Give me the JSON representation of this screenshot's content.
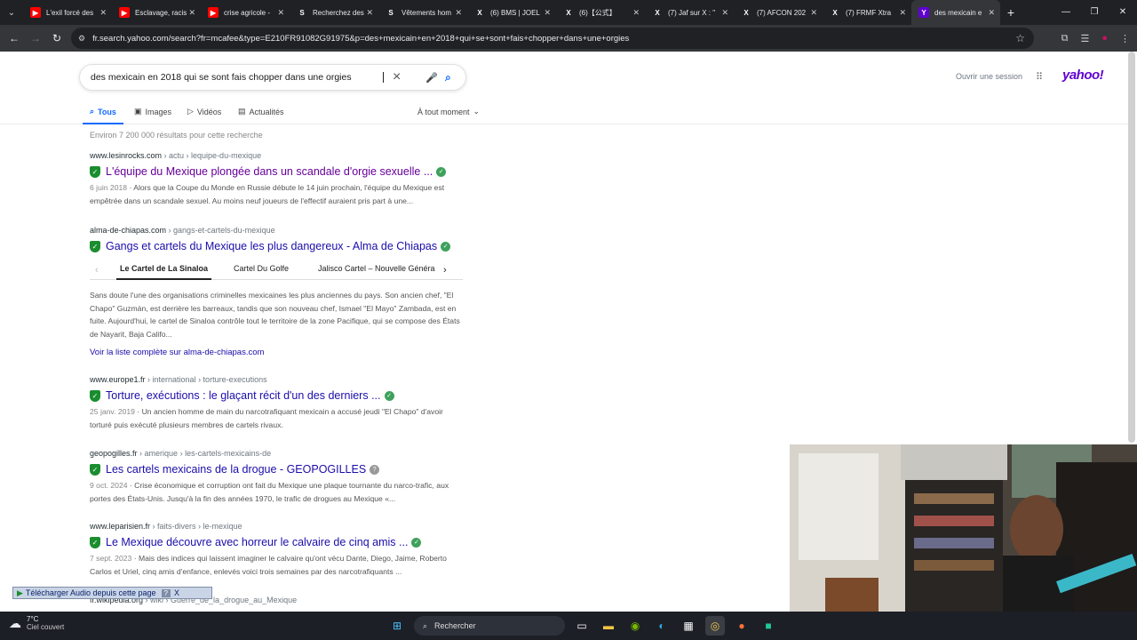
{
  "browser": {
    "tabs": [
      {
        "title": "L'exil forcé des",
        "icon": "youtube-icon",
        "color": "#ff0000",
        "glyph": "▶"
      },
      {
        "title": "Esclavage, racis",
        "icon": "youtube-icon",
        "color": "#ff0000",
        "glyph": "▶"
      },
      {
        "title": "crise agricole - ",
        "icon": "youtube-icon",
        "color": "#ff0000",
        "glyph": "▶"
      },
      {
        "title": "Recherchez des",
        "icon": "s-icon",
        "color": "#202124",
        "glyph": "S"
      },
      {
        "title": "Vêtements hom",
        "icon": "s-icon",
        "color": "#202124",
        "glyph": "S"
      },
      {
        "title": "(6) BMS | JOEL",
        "icon": "x-icon",
        "color": "#202124",
        "glyph": "X"
      },
      {
        "title": "(6)【公式】",
        "icon": "x-icon",
        "color": "#202124",
        "glyph": "X"
      },
      {
        "title": "(7) Jaf sur X : \"",
        "icon": "x-icon",
        "color": "#202124",
        "glyph": "X"
      },
      {
        "title": "(7) AFCON 202",
        "icon": "x-icon",
        "color": "#202124",
        "glyph": "X"
      },
      {
        "title": "(7) FRMF Xtra",
        "icon": "x-icon",
        "color": "#202124",
        "glyph": "X"
      },
      {
        "title": "des mexicain e",
        "icon": "yahoo-icon",
        "color": "#5f01d1",
        "glyph": "Y"
      }
    ],
    "url": "fr.search.yahoo.com/search?fr=mcafee&type=E210FR91082G91975&p=des+mexicain+en+2018+qui+se+sont+fais+chopper+dans+une+orgies"
  },
  "search": {
    "query": "des mexicain en 2018 qui se sont fais chopper dans une orgies",
    "signin": "Ouvrir une session",
    "logo": "yahoo!",
    "tabs": {
      "all": "Tous",
      "images": "Images",
      "videos": "Vidéos",
      "news": "Actualités",
      "time": "À tout moment"
    },
    "count": "Environ 7 200 000 résultats pour cette recherche"
  },
  "results": [
    {
      "domain": "www.lesinrocks.com",
      "path": " › actu › lequipe-du-mexique",
      "title": "L'équipe du Mexique plongée dans un scandale d'orgie sexuelle ...",
      "snippet_date": "6 juin 2018",
      "snippet": " · Alors que la Coupe du Monde en Russie débute le 14 juin prochain, l'équipe du Mexique est empêtrée dans un scandale sexuel. Au moins neuf joueurs de l'effectif auraient pris part à une..."
    },
    {
      "domain": "alma-de-chiapas.com",
      "path": " › gangs-et-cartels-du-mexique",
      "title": "Gangs et cartels du Mexique les plus dangereux - Alma de Chiapas",
      "carousel": [
        "Le Cartel de La Sinaloa",
        "Cartel Du Golfe",
        "Jalisco Cartel – Nouvelle Généra"
      ],
      "snippet": "Sans doute l'une des organisations criminelles mexicaines les plus anciennes du pays. Son ancien chef, \"El Chapo\" Guzmán, est derrière les barreaux, tandis que son nouveau chef, Ismael \"El Mayo\" Zambada, est en fuite. Aujourd'hui, le cartel de Sinaloa contrôle tout le territoire de la zone Pacifique, qui se compose des États de Nayarit, Baja Califo...",
      "more": "Voir la liste complète sur alma-de-chiapas.com"
    },
    {
      "domain": "www.europe1.fr",
      "path": " › international › torture-executions",
      "title": "Torture, exécutions : le glaçant récit d'un des derniers ...",
      "snippet_date": "25 janv. 2019",
      "snippet": " · Un ancien homme de main du narcotrafiquant mexicain a accusé jeudi \"El Chapo\" d'avoir torturé puis exécuté plusieurs membres de cartels rivaux."
    },
    {
      "domain": "geopogilles.fr",
      "path": " › amerique › les-cartels-mexicains-de",
      "title": "Les cartels mexicains de la drogue - GEOPOGILLES",
      "snippet_date": "9 oct. 2024",
      "snippet": " · Crise économique et corruption ont fait du Mexique une plaque tournante du narco-trafic, aux portes des États-Unis. Jusqu'à la fin des années 1970, le trafic de drogues au Mexique «..."
    },
    {
      "domain": "www.leparisien.fr",
      "path": " › faits-divers › le-mexique",
      "title": "Le Mexique découvre avec horreur le calvaire de cinq amis ...",
      "snippet_date": "7 sept. 2023",
      "snippet": " · Mais des indices qui laissent imaginer le calvaire qu'ont vécu Dante, Diego, Jaime, Roberto Carlos et Uriel, cinq amis d'enfance, enlevés voici trois semaines par des narcotrafiquants ..."
    },
    {
      "domain": "fr.wikipedia.org",
      "path": " › wiki › Guerre_de_la_drogue_au_Mexique"
    }
  ],
  "download_bar": {
    "label": "Télécharger Audio depuis cette page",
    "help": "?",
    "close": "X"
  },
  "taskbar": {
    "temp": "7°C",
    "weather": "Ciel couvert",
    "search": "Rechercher"
  }
}
